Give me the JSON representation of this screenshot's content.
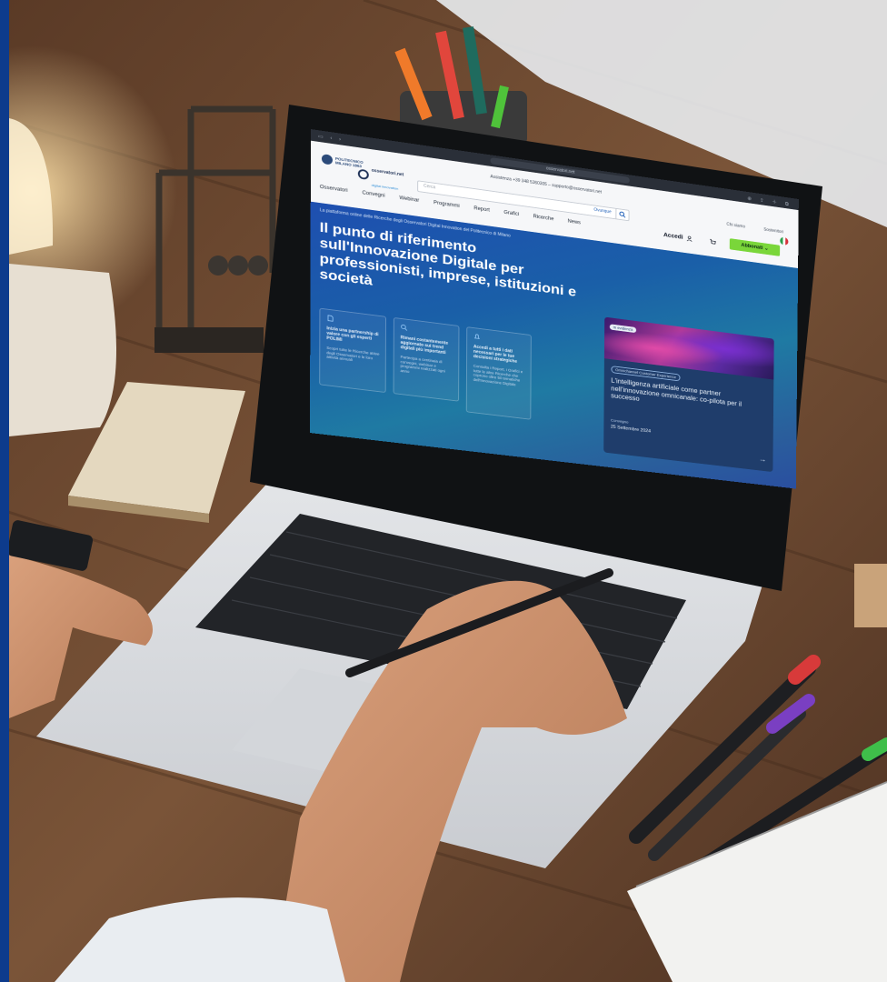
{
  "photo": {
    "description_colors": {
      "desk": "#6b4a33",
      "edge": "#0d3b8c"
    }
  },
  "browser": {
    "url": "osservatori.net"
  },
  "site": {
    "logo_poli_line1": "POLITECNICO",
    "logo_poli_line2": "MILANO 1863",
    "logo_oss_line1": "osservatori.net",
    "logo_oss_line2": "digital innovation",
    "assistance": "Assistenza  +39 348 5360305 – supporto@osservatori.net",
    "search_placeholder": "Cerca",
    "search_scope": "Ovunque",
    "top_link_1": "Chi siamo",
    "top_link_2": "Sostenitori",
    "nav": [
      "Osservatori",
      "Convegni",
      "Webinar",
      "Programmi",
      "Report",
      "Grafici",
      "Ricerche",
      "News"
    ],
    "accedi": "Accedi",
    "abbonati": "Abbonati",
    "colors": {
      "accent_green": "#7ad63a",
      "hero_blue": "#1e4fb0"
    }
  },
  "hero": {
    "tagline": "La piattaforma online delle Ricerche degli Osservatori Digital Innovation del Politecnico di Milano",
    "title": "Il punto di riferimento sull'Innovazione Digitale per professionisti, imprese, istituzioni e società"
  },
  "cards": [
    {
      "icon": "document-icon",
      "title": "Inizia una partnership di valore con gli esperti POLIMI",
      "desc": "Scopri tutte le Ricerche attive degli Osservatori e le loro attività annuali"
    },
    {
      "icon": "search-icon",
      "title": "Rimani costantemente aggiornato sui trend digitali più importanti",
      "desc": "Partecipa a centinaia di convegni, webinar e programmi realizzati ogni anno"
    },
    {
      "icon": "bell-icon",
      "title": "Accedi a tutti i dati necessari per le tue decisioni strategiche",
      "desc": "Consulta i Report, i Grafici e tutte le altre Ricerche che coprono oltre 50 tematiche dell'Innovazione Digitale"
    }
  ],
  "featured": {
    "badge": "In evidenza",
    "category": "Omnichannel Customer Experience",
    "title": "L'intelligenza artificiale come partner nell'innovazione omnicanale: co-pilota per il successo",
    "kind": "Convegno",
    "date": "25 Settembre 2024",
    "arrow": "→"
  }
}
